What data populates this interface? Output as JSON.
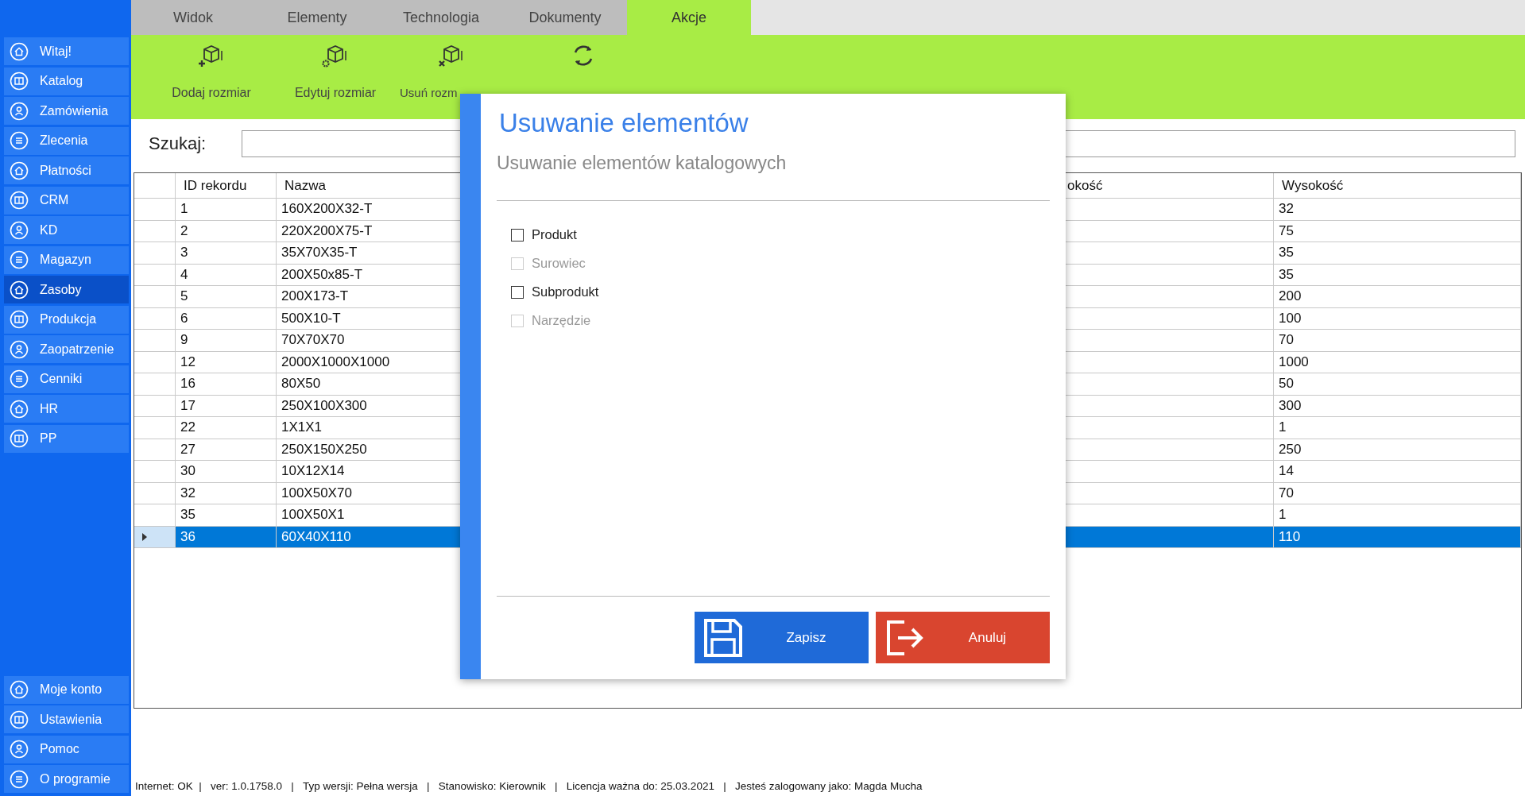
{
  "sidebar": {
    "items": [
      {
        "label": "Witaj!",
        "selected": false
      },
      {
        "label": "Katalog",
        "selected": false
      },
      {
        "label": "Zamówienia",
        "selected": false
      },
      {
        "label": "Zlecenia",
        "selected": false
      },
      {
        "label": "Płatności",
        "selected": false
      },
      {
        "label": "CRM",
        "selected": false
      },
      {
        "label": "KD",
        "selected": false
      },
      {
        "label": "Magazyn",
        "selected": false
      },
      {
        "label": "Zasoby",
        "selected": true
      },
      {
        "label": "Produkcja",
        "selected": false
      },
      {
        "label": "Zaopatrzenie",
        "selected": false
      },
      {
        "label": "Cenniki",
        "selected": false
      },
      {
        "label": "HR",
        "selected": false
      },
      {
        "label": "PP",
        "selected": false
      }
    ],
    "bottom_items": [
      {
        "label": "Moje konto",
        "selected": false
      },
      {
        "label": "Ustawienia",
        "selected": false
      },
      {
        "label": "Pomoc",
        "selected": false
      },
      {
        "label": "O programie",
        "selected": false
      }
    ]
  },
  "tabs": [
    {
      "label": "Widok",
      "selected": false
    },
    {
      "label": "Elementy",
      "selected": false
    },
    {
      "label": "Technologia",
      "selected": false
    },
    {
      "label": "Dokumenty",
      "selected": false
    },
    {
      "label": "Akcje",
      "selected": true
    }
  ],
  "toolbar": [
    {
      "kind": "add",
      "label": "Dodaj rozmiar"
    },
    {
      "kind": "edit",
      "label": "Edytuj rozmiar"
    },
    {
      "kind": "delete",
      "label": "Usuń rozm"
    },
    {
      "kind": "refresh"
    }
  ],
  "search": {
    "label": "Szukaj:"
  },
  "table": {
    "columns": [
      "ID rekordu",
      "Nazwa",
      "okość",
      "Wysokość"
    ],
    "rows": [
      {
        "id": "1",
        "nazwa": "160X200X32-T",
        "wysokosc": "32",
        "selected": false
      },
      {
        "id": "2",
        "nazwa": "220X200X75-T",
        "wysokosc": "75",
        "selected": false
      },
      {
        "id": "3",
        "nazwa": "35X70X35-T",
        "wysokosc": "35",
        "selected": false
      },
      {
        "id": "4",
        "nazwa": "200X50x85-T",
        "wysokosc": "35",
        "selected": false
      },
      {
        "id": "5",
        "nazwa": "200X173-T",
        "wysokosc": "200",
        "selected": false
      },
      {
        "id": "6",
        "nazwa": "500X10-T",
        "wysokosc": "100",
        "selected": false
      },
      {
        "id": "9",
        "nazwa": "70X70X70",
        "wysokosc": "70",
        "selected": false
      },
      {
        "id": "12",
        "nazwa": "2000X1000X1000",
        "wysokosc": "1000",
        "selected": false
      },
      {
        "id": "16",
        "nazwa": "80X50",
        "wysokosc": "50",
        "selected": false
      },
      {
        "id": "17",
        "nazwa": "250X100X300",
        "wysokosc": "300",
        "selected": false
      },
      {
        "id": "22",
        "nazwa": "1X1X1",
        "wysokosc": "1",
        "selected": false
      },
      {
        "id": "27",
        "nazwa": "250X150X250",
        "wysokosc": "250",
        "selected": false
      },
      {
        "id": "30",
        "nazwa": "10X12X14",
        "wysokosc": "14",
        "selected": false
      },
      {
        "id": "32",
        "nazwa": "100X50X70",
        "wysokosc": "70",
        "selected": false
      },
      {
        "id": "35",
        "nazwa": "100X50X1",
        "wysokosc": "1",
        "selected": false
      },
      {
        "id": "36",
        "nazwa": "60X40X110",
        "wysokosc": "110",
        "selected": true
      }
    ]
  },
  "dialog": {
    "title": "Usuwanie elementów",
    "subtitle": "Usuwanie elementów katalogowych",
    "options": [
      {
        "label": "Produkt",
        "checked": false,
        "disabled": false
      },
      {
        "label": "Surowiec",
        "checked": false,
        "disabled": true
      },
      {
        "label": "Subprodukt",
        "checked": false,
        "disabled": false
      },
      {
        "label": "Narzędzie",
        "checked": false,
        "disabled": true
      }
    ],
    "buttons": [
      {
        "kind": "save",
        "label": "Zapisz"
      },
      {
        "kind": "cancel",
        "label": "Anuluj"
      }
    ]
  },
  "status_bar": "Internet: OK  |   ver: 1.0.1758.0   |   Typ wersji: Pełna wersja   |   Stanowisko: Kierownik   |   Licencja ważna do: 25.03.2021   |   Jesteś zalogowany jako: Magda Mucha"
}
